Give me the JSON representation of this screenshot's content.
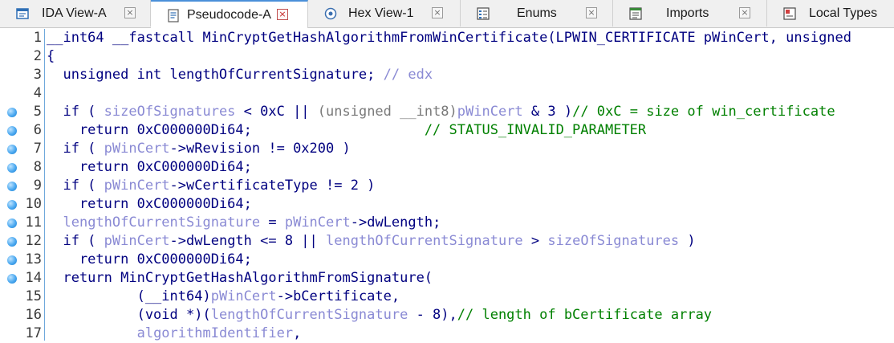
{
  "tabs": [
    {
      "label": "IDA View-A",
      "icon": "ida-view-icon",
      "active": false
    },
    {
      "label": "Pseudocode-A",
      "icon": "pseudocode-icon",
      "active": true
    },
    {
      "label": "Hex View-1",
      "icon": "hex-view-icon",
      "active": false
    },
    {
      "label": "Enums",
      "icon": "enums-icon",
      "active": false
    },
    {
      "label": "Imports",
      "icon": "imports-icon",
      "active": false
    },
    {
      "label": "Local Types",
      "icon": "local-types-icon",
      "active": false
    }
  ],
  "tab_close_glyph": "×",
  "colors": {
    "keyword": "#000080",
    "variable": "#8a8ad4",
    "comment": "#008000",
    "breakpoint": "#4aa8f0",
    "active_tab_accent": "#4a90d9"
  },
  "lines": [
    {
      "n": "1",
      "bp": false,
      "tokens": [
        [
          "k",
          "__int64 __fastcall MinCryptGetHashAlgorithmFromWinCertificate(LPWIN_CERTIFICATE pWinCert, unsigned"
        ]
      ]
    },
    {
      "n": "2",
      "bp": false,
      "tokens": [
        [
          "k",
          "{"
        ]
      ]
    },
    {
      "n": "3",
      "bp": false,
      "tokens": [
        [
          "k",
          "  unsigned int lengthOfCurrentSignature; "
        ],
        [
          "v",
          "// edx"
        ]
      ]
    },
    {
      "n": "4",
      "bp": false,
      "tokens": [
        [
          "k",
          ""
        ]
      ]
    },
    {
      "n": "5",
      "bp": true,
      "tokens": [
        [
          "k",
          "  if ( "
        ],
        [
          "v",
          "sizeOfSignatures"
        ],
        [
          "k",
          " < 0xC || "
        ],
        [
          "g",
          "(unsigned __int8)"
        ],
        [
          "v",
          "pWinCert"
        ],
        [
          "k",
          " & 3 )"
        ],
        [
          "c",
          "// 0xC = size of win_certificate"
        ]
      ]
    },
    {
      "n": "6",
      "bp": true,
      "tokens": [
        [
          "k",
          "    return 0xC000000Di64;                     "
        ],
        [
          "c",
          "// STATUS_INVALID_PARAMETER"
        ]
      ]
    },
    {
      "n": "7",
      "bp": true,
      "tokens": [
        [
          "k",
          "  if ( "
        ],
        [
          "v",
          "pWinCert"
        ],
        [
          "k",
          "->wRevision != 0x200 )"
        ]
      ]
    },
    {
      "n": "8",
      "bp": true,
      "tokens": [
        [
          "k",
          "    return 0xC000000Di64;"
        ]
      ]
    },
    {
      "n": "9",
      "bp": true,
      "tokens": [
        [
          "k",
          "  if ( "
        ],
        [
          "v",
          "pWinCert"
        ],
        [
          "k",
          "->wCertificateType != 2 )"
        ]
      ]
    },
    {
      "n": "10",
      "bp": true,
      "tokens": [
        [
          "k",
          "    return 0xC000000Di64;"
        ]
      ]
    },
    {
      "n": "11",
      "bp": true,
      "tokens": [
        [
          "k",
          "  "
        ],
        [
          "v",
          "lengthOfCurrentSignature"
        ],
        [
          "k",
          " = "
        ],
        [
          "v",
          "pWinCert"
        ],
        [
          "k",
          "->dwLength;"
        ]
      ]
    },
    {
      "n": "12",
      "bp": true,
      "tokens": [
        [
          "k",
          "  if ( "
        ],
        [
          "v",
          "pWinCert"
        ],
        [
          "k",
          "->dwLength <= 8 || "
        ],
        [
          "v",
          "lengthOfCurrentSignature"
        ],
        [
          "k",
          " > "
        ],
        [
          "v",
          "sizeOfSignatures"
        ],
        [
          "k",
          " )"
        ]
      ]
    },
    {
      "n": "13",
      "bp": true,
      "tokens": [
        [
          "k",
          "    return 0xC000000Di64;"
        ]
      ]
    },
    {
      "n": "14",
      "bp": true,
      "tokens": [
        [
          "k",
          "  return MinCryptGetHashAlgorithmFromSignature("
        ]
      ]
    },
    {
      "n": "15",
      "bp": false,
      "tokens": [
        [
          "k",
          "           (__int64)"
        ],
        [
          "v",
          "pWinCert"
        ],
        [
          "k",
          "->bCertificate,"
        ]
      ]
    },
    {
      "n": "16",
      "bp": false,
      "tokens": [
        [
          "k",
          "           (void *)("
        ],
        [
          "v",
          "lengthOfCurrentSignature"
        ],
        [
          "k",
          " - 8),"
        ],
        [
          "c",
          "// length of bCertificate array"
        ]
      ]
    },
    {
      "n": "17",
      "bp": false,
      "tokens": [
        [
          "k",
          "           "
        ],
        [
          "v",
          "algorithmIdentifier"
        ],
        [
          "k",
          ","
        ]
      ]
    }
  ]
}
